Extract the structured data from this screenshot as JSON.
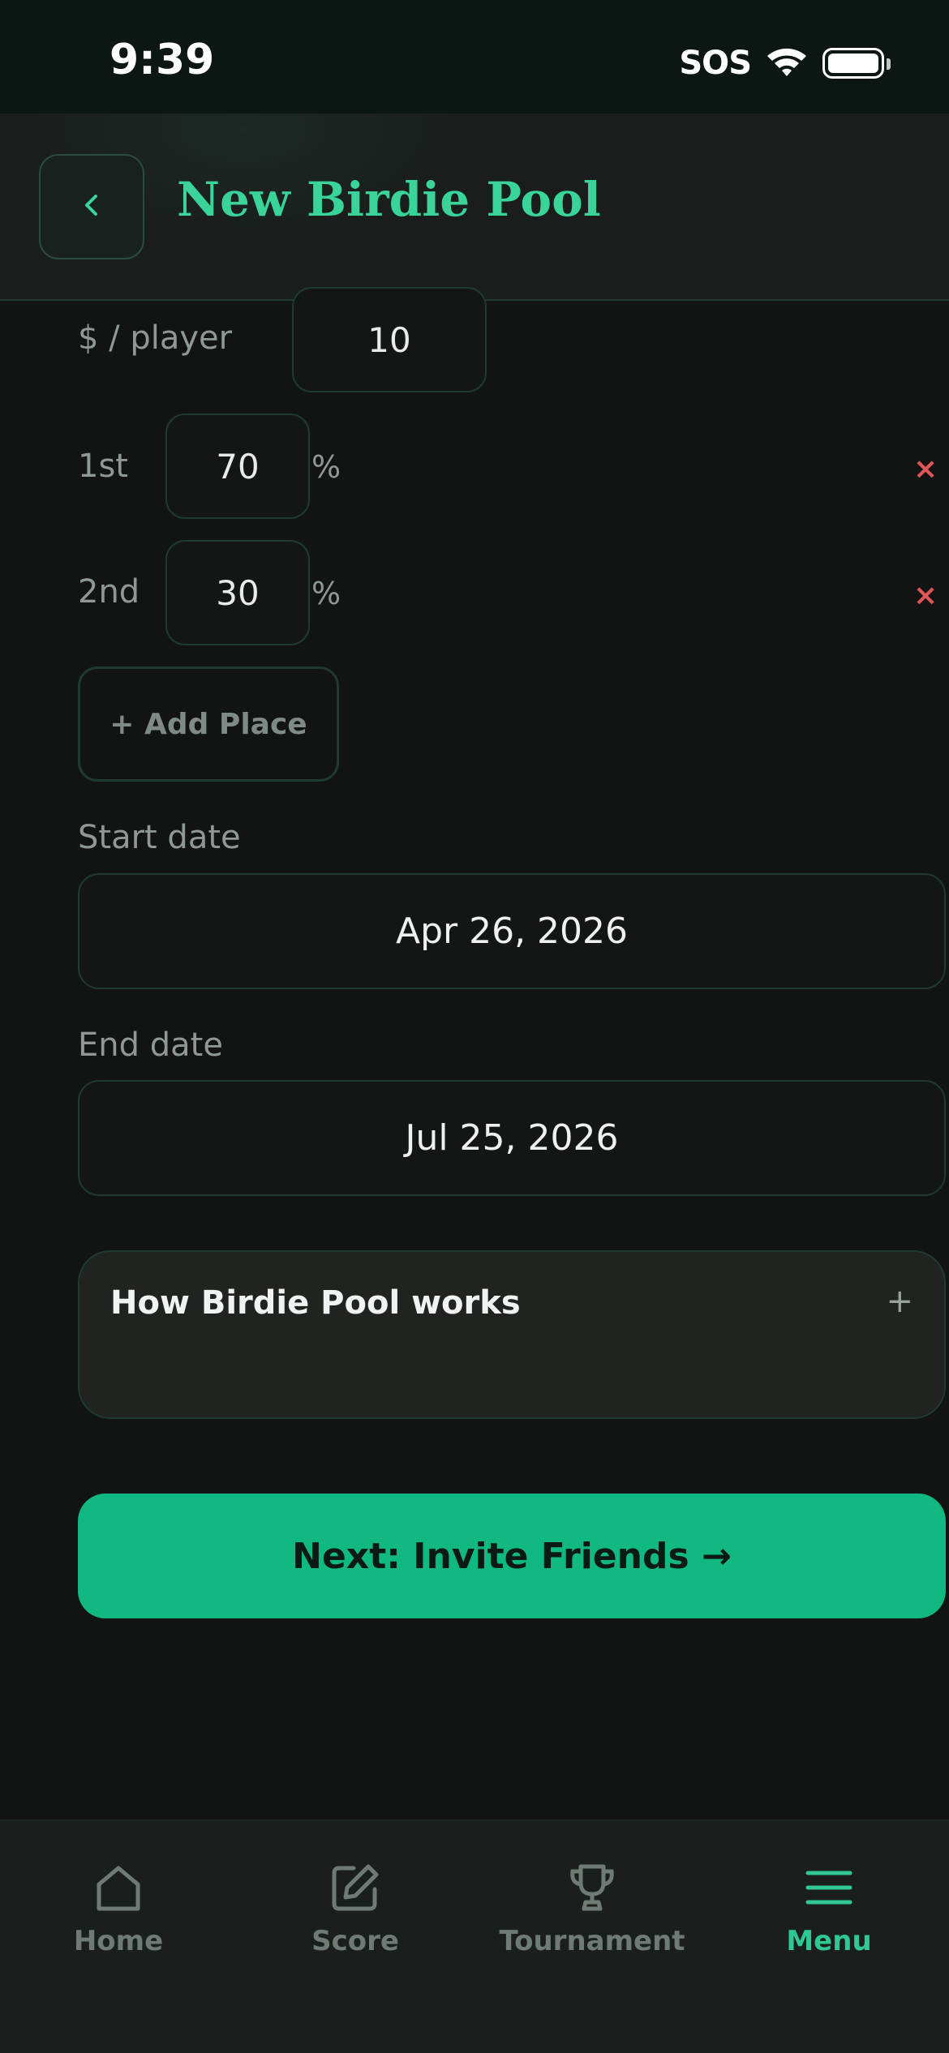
{
  "status_bar": {
    "time": "9:39",
    "carrier": "SOS"
  },
  "header": {
    "title": "New Birdie Pool"
  },
  "buy_in": {
    "label": "$ / player",
    "value": "10"
  },
  "places": [
    {
      "label": "1st",
      "percent": "70",
      "unit": "%",
      "remove": "×"
    },
    {
      "label": "2nd",
      "percent": "30",
      "unit": "%",
      "remove": "×"
    }
  ],
  "add_place_label": "+ Add Place",
  "start_date": {
    "label": "Start date",
    "value": "Apr 26, 2026"
  },
  "end_date": {
    "label": "End date",
    "value": "Jul 25, 2026"
  },
  "how_it_works": {
    "title": "How Birdie Pool works",
    "toggle": "+"
  },
  "next_button": {
    "label": "Next: Invite Friends →"
  },
  "nav": {
    "items": [
      {
        "label": "Home",
        "icon": "home-icon"
      },
      {
        "label": "Score",
        "icon": "edit-icon"
      },
      {
        "label": "Tournament",
        "icon": "trophy-icon"
      },
      {
        "label": "Menu",
        "icon": "menu-icon",
        "active": true
      }
    ]
  },
  "colors": {
    "accent": "#12b882",
    "title": "#3ad39a",
    "danger": "#e05555",
    "background": "#111412"
  }
}
